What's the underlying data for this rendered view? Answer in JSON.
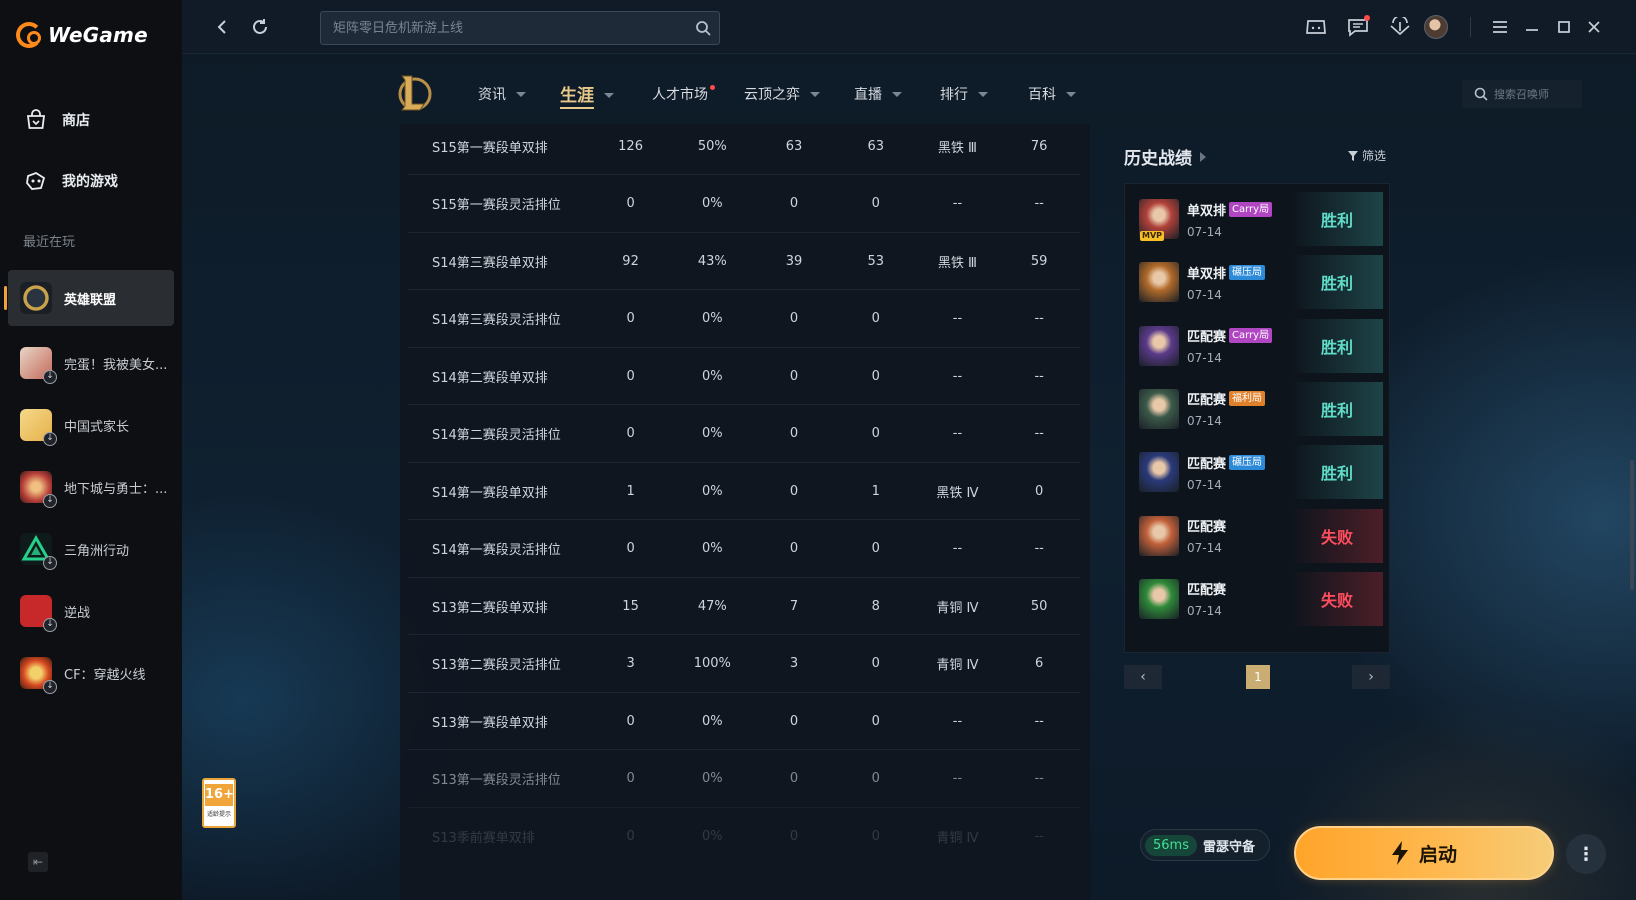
{
  "app": {
    "name": "WeGame"
  },
  "sidebar": {
    "nav": [
      {
        "label": "商店",
        "icon": "store-bag-icon"
      },
      {
        "label": "我的游戏",
        "icon": "game-controller-icon"
      }
    ],
    "recent_label": "最近在玩",
    "games": [
      {
        "name": "英雄联盟",
        "active": true,
        "color": "#c9a24b"
      },
      {
        "name": "完蛋！我被美女...",
        "active": false,
        "color": "#c46a5a"
      },
      {
        "name": "中国式家长",
        "active": false,
        "color": "#e6b04a"
      },
      {
        "name": "地下城与勇士：...",
        "active": false,
        "color": "#b8403a"
      },
      {
        "name": "三角洲行动",
        "active": false,
        "color": "#25b07a"
      },
      {
        "name": "逆战",
        "active": false,
        "color": "#c7282a"
      },
      {
        "name": "CF：穿越火线",
        "active": false,
        "color": "#d84a22"
      }
    ]
  },
  "topbar": {
    "search_placeholder": "矩阵零日危机新游上线"
  },
  "lol_nav": {
    "tabs": [
      {
        "label": "资讯",
        "caret": true
      },
      {
        "label": "生涯",
        "caret": true,
        "active": true
      },
      {
        "label": "人才市场",
        "caret": false,
        "dot": true
      },
      {
        "label": "云顶之弈",
        "caret": true
      },
      {
        "label": "直播",
        "caret": true
      },
      {
        "label": "排行",
        "caret": true
      },
      {
        "label": "百科",
        "caret": true
      }
    ],
    "summoner_search_placeholder": "搜索召唤师"
  },
  "stats_table": {
    "rows": [
      [
        "S15第一赛段单双排",
        "126",
        "50%",
        "63",
        "63",
        "黑铁 Ⅲ",
        "76"
      ],
      [
        "S15第一赛段灵活排位",
        "0",
        "0%",
        "0",
        "0",
        "--",
        "--"
      ],
      [
        "S14第三赛段单双排",
        "92",
        "43%",
        "39",
        "53",
        "黑铁 Ⅲ",
        "59"
      ],
      [
        "S14第三赛段灵活排位",
        "0",
        "0%",
        "0",
        "0",
        "--",
        "--"
      ],
      [
        "S14第二赛段单双排",
        "0",
        "0%",
        "0",
        "0",
        "--",
        "--"
      ],
      [
        "S14第二赛段灵活排位",
        "0",
        "0%",
        "0",
        "0",
        "--",
        "--"
      ],
      [
        "S14第一赛段单双排",
        "1",
        "0%",
        "0",
        "1",
        "黑铁 Ⅳ",
        "0"
      ],
      [
        "S14第一赛段灵活排位",
        "0",
        "0%",
        "0",
        "0",
        "--",
        "--"
      ],
      [
        "S13第二赛段单双排",
        "15",
        "47%",
        "7",
        "8",
        "青铜 Ⅳ",
        "50"
      ],
      [
        "S13第二赛段灵活排位",
        "3",
        "100%",
        "3",
        "0",
        "青铜 Ⅳ",
        "6"
      ],
      [
        "S13第一赛段单双排",
        "0",
        "0%",
        "0",
        "0",
        "--",
        "--"
      ],
      [
        "S13第一赛段灵活排位",
        "0",
        "0%",
        "0",
        "0",
        "--",
        "--"
      ],
      [
        "S13季前赛单双排",
        "0",
        "0%",
        "0",
        "0",
        "青铜 Ⅳ",
        "--"
      ]
    ]
  },
  "history": {
    "title": "历史战绩",
    "filter_label": "筛选",
    "matches": [
      {
        "mode": "单双排",
        "tag": "Carry局",
        "tag_color": "#b146c2",
        "date": "07-14",
        "result": "胜利",
        "win": true,
        "mvp": "MVP",
        "champ_color": "#b0413a"
      },
      {
        "mode": "单双排",
        "tag": "碾压局",
        "tag_color": "#2c8ad8",
        "date": "07-14",
        "result": "胜利",
        "win": true,
        "mvp": "",
        "champ_color": "#b06a2a"
      },
      {
        "mode": "匹配赛",
        "tag": "Carry局",
        "tag_color": "#b146c2",
        "date": "07-14",
        "result": "胜利",
        "win": true,
        "mvp": "",
        "champ_color": "#5a3a8a"
      },
      {
        "mode": "匹配赛",
        "tag": "福利局",
        "tag_color": "#e0802a",
        "date": "07-14",
        "result": "胜利",
        "win": true,
        "mvp": "",
        "champ_color": "#3c5a4a"
      },
      {
        "mode": "匹配赛",
        "tag": "碾压局",
        "tag_color": "#2c8ad8",
        "date": "07-14",
        "result": "胜利",
        "win": true,
        "mvp": "",
        "champ_color": "#2a3a7a"
      },
      {
        "mode": "匹配赛",
        "tag": "",
        "tag_color": "",
        "date": "07-14",
        "result": "失败",
        "win": false,
        "mvp": "",
        "champ_color": "#c0603a"
      },
      {
        "mode": "匹配赛",
        "tag": "",
        "tag_color": "",
        "date": "07-14",
        "result": "失败",
        "win": false,
        "mvp": "",
        "champ_color": "#2f8a3a"
      }
    ],
    "page": "1"
  },
  "launch": {
    "ping": "56ms",
    "server": "雷瑟守备",
    "button_label": "启动"
  },
  "age_rating": {
    "value": "16+",
    "sub": "适龄提示"
  }
}
